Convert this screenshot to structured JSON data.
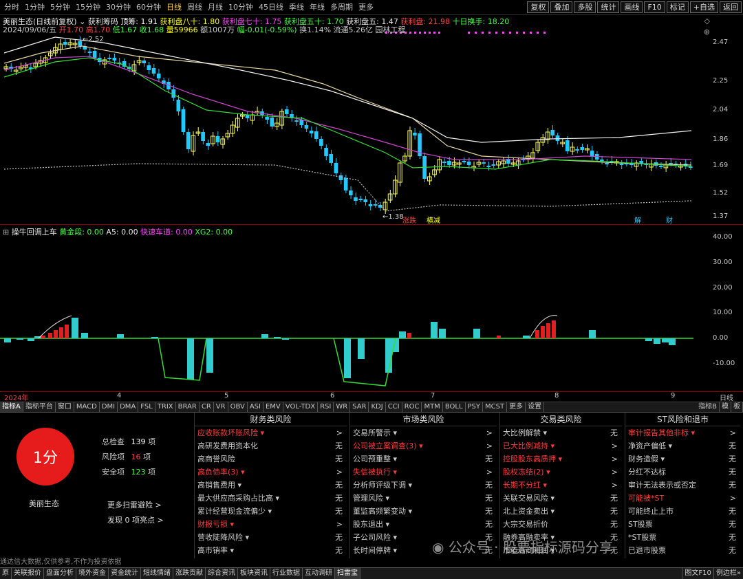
{
  "periods": [
    "分时",
    "1分钟",
    "5分钟",
    "15分钟",
    "30分钟",
    "60分钟",
    "日线",
    "周线",
    "月线",
    "10分钟",
    "45日线",
    "季线",
    "年线",
    "多周期",
    "更多"
  ],
  "active_period": "日线",
  "right_tools": [
    "复权",
    "叠加",
    "多股",
    "统计",
    "画线",
    "F10",
    "标记",
    "+自选",
    "返回"
  ],
  "kline": {
    "title": "美丽生态(日线前复权)",
    "chip_label": "获利筹码",
    "top_chip": "顶筹: 1.91",
    "p80": "获利盘八十: 1.80",
    "p70": "获利盘七十: 1.75",
    "p50": "获利盘五十: 1.70",
    "p5": "获利盘五: 1.47",
    "pmain": "获利盘: 21.98",
    "tenday": "十日换手: 18.20",
    "info_date": "2024/09/06/五",
    "info_open": "开1.70",
    "info_high": "高1.70",
    "info_low": "低1.67",
    "info_close": "收1.68",
    "info_vol": "量59966",
    "info_amt": "额1007万",
    "info_chg": "幅-0.01(-0.59%)",
    "info_turn": "换1.14%",
    "info_float": "流通5.26亿",
    "info_sector": "园林工程",
    "high_mark": "2.52",
    "low_mark": "1.38",
    "price_axis": [
      "2.47",
      "2.25",
      "2.04",
      "1.86",
      "1.69",
      "1.52",
      "1.37"
    ],
    "tags": [
      "涨跌",
      "横减",
      "解",
      "财"
    ]
  },
  "indicator": {
    "name": "操牛回调上车",
    "gold": "黄金段: 0.00",
    "a5": "A5: 0.00",
    "fast": "快速车道: 0.00",
    "xg2": "XG2: 0.00",
    "axis": [
      "40.00",
      "30.00",
      "20.00",
      "10.00",
      "0.00",
      "-10.00"
    ]
  },
  "xaxis": {
    "year": "2024年",
    "m4": "4",
    "m5": "5",
    "m6": "6",
    "m7": "7",
    "m8": "8",
    "m9": "9",
    "unit": "日线"
  },
  "ind_tabs": [
    "指标A",
    "指标平台",
    "窗口",
    "MACD",
    "DMI",
    "DMA",
    "FSL",
    "TRIX",
    "BRAR",
    "CR",
    "VR",
    "OBV",
    "ASI",
    "EMV",
    "VOL-TDX",
    "RSI",
    "WR",
    "SAR",
    "KDJ",
    "CCI",
    "ROC",
    "MTM",
    "BOLL",
    "PSY",
    "MCST",
    "更多",
    "设置"
  ],
  "ind_tabs_right": [
    "指标B",
    "模",
    "板"
  ],
  "risk": {
    "score": "1分",
    "stock": "美丽生态",
    "total_label": "总检查",
    "total_val": "139",
    "unit": "项",
    "risk_label": "风险项",
    "risk_val": "16",
    "safe_label": "安全项",
    "safe_val": "123",
    "more": "更多扫雷避险 >",
    "discover": "发现 0 项亮点 >",
    "disclaimer": "通达信大数据,仅供参考,不作为投资依据",
    "watermark": "公众号 · 股票指标源码分享",
    "columns": [
      {
        "title": "财务类风险",
        "rows": [
          {
            "t": "应收账款坏账风险 ▾",
            "v": ">",
            "red": true
          },
          {
            "t": "高研发费用资本化",
            "v": "无"
          },
          {
            "t": "高商誉风险",
            "v": "无"
          },
          {
            "t": "高负债率(3) ▾",
            "v": ">",
            "red": true
          },
          {
            "t": "高销售费用 ▾",
            "v": "无"
          },
          {
            "t": "最大供应商采购占比高 ▾",
            "v": "无"
          },
          {
            "t": "累计经营现金流偏少 ▾",
            "v": "无"
          },
          {
            "t": "财报亏损 ▾",
            "v": ">",
            "red": true
          },
          {
            "t": "营收陡降风险 ▾",
            "v": "无"
          },
          {
            "t": "高市销率 ▾",
            "v": "无"
          }
        ]
      },
      {
        "title": "市场类风险",
        "rows": [
          {
            "t": "交易所警示 ▾",
            "v": ">"
          },
          {
            "t": "公司被立案调查(3) ▾",
            "v": ">",
            "red": true
          },
          {
            "t": "公司预重整 ▾",
            "v": "无"
          },
          {
            "t": "失信被执行 ▾",
            "v": ">",
            "red": true
          },
          {
            "t": "分析师评级下调 ▾",
            "v": "无"
          },
          {
            "t": "管理风险 ▾",
            "v": "无"
          },
          {
            "t": "董监高频繁变动 ▾",
            "v": "无"
          },
          {
            "t": "股东退出 ▾",
            "v": "无"
          },
          {
            "t": "子公司风险 ▾",
            "v": "无"
          },
          {
            "t": "长时间停牌 ▾",
            "v": "无"
          }
        ]
      },
      {
        "title": "交易类风险",
        "rows": [
          {
            "t": "大比例解禁 ▾",
            "v": "无"
          },
          {
            "t": "已大比例减持 ▾",
            "v": ">",
            "red": true
          },
          {
            "t": "控股股东高质押 ▾",
            "v": ">",
            "red": true
          },
          {
            "t": "股权冻结(2) ▾",
            "v": ">",
            "red": true
          },
          {
            "t": "长期不分红 ▾",
            "v": ">",
            "red": true
          },
          {
            "t": "关联交易风险 ▾",
            "v": "无"
          },
          {
            "t": "北上资金卖出 ▾",
            "v": "无"
          },
          {
            "t": "大宗交易折价",
            "v": "无"
          },
          {
            "t": "融券高融卖率 ▾",
            "v": "无"
          },
          {
            "t": "市值高商利润 ▾",
            "v": "无"
          }
        ]
      },
      {
        "title": "ST风险和退市",
        "rows": [
          {
            "t": "审计报告其他非标 ▾",
            "v": ">",
            "red": true
          },
          {
            "t": "净资产偏低 ▾",
            "v": "无"
          },
          {
            "t": "财务造假 ▾",
            "v": "无"
          },
          {
            "t": "分红不达标",
            "v": "无"
          },
          {
            "t": "审计无法表示或否定",
            "v": "无"
          },
          {
            "t": "可能被*ST",
            "v": ">",
            "red": true
          },
          {
            "t": "可能终止上市",
            "v": "无"
          },
          {
            "t": "ST股票",
            "v": "无"
          },
          {
            "t": "*ST股票",
            "v": "无"
          },
          {
            "t": "已退市股票",
            "v": "无"
          }
        ]
      }
    ]
  },
  "bottom_tabs": [
    "原",
    "关联报价",
    "盘面分析",
    "境外资金",
    "资金统计",
    "短线情绪",
    "涨跌贡献",
    "综合资讯",
    "板块资讯",
    "行业数据",
    "互动调研",
    "扫雷宝"
  ],
  "bottom_right": [
    "图文F10",
    "例边栏»"
  ]
}
